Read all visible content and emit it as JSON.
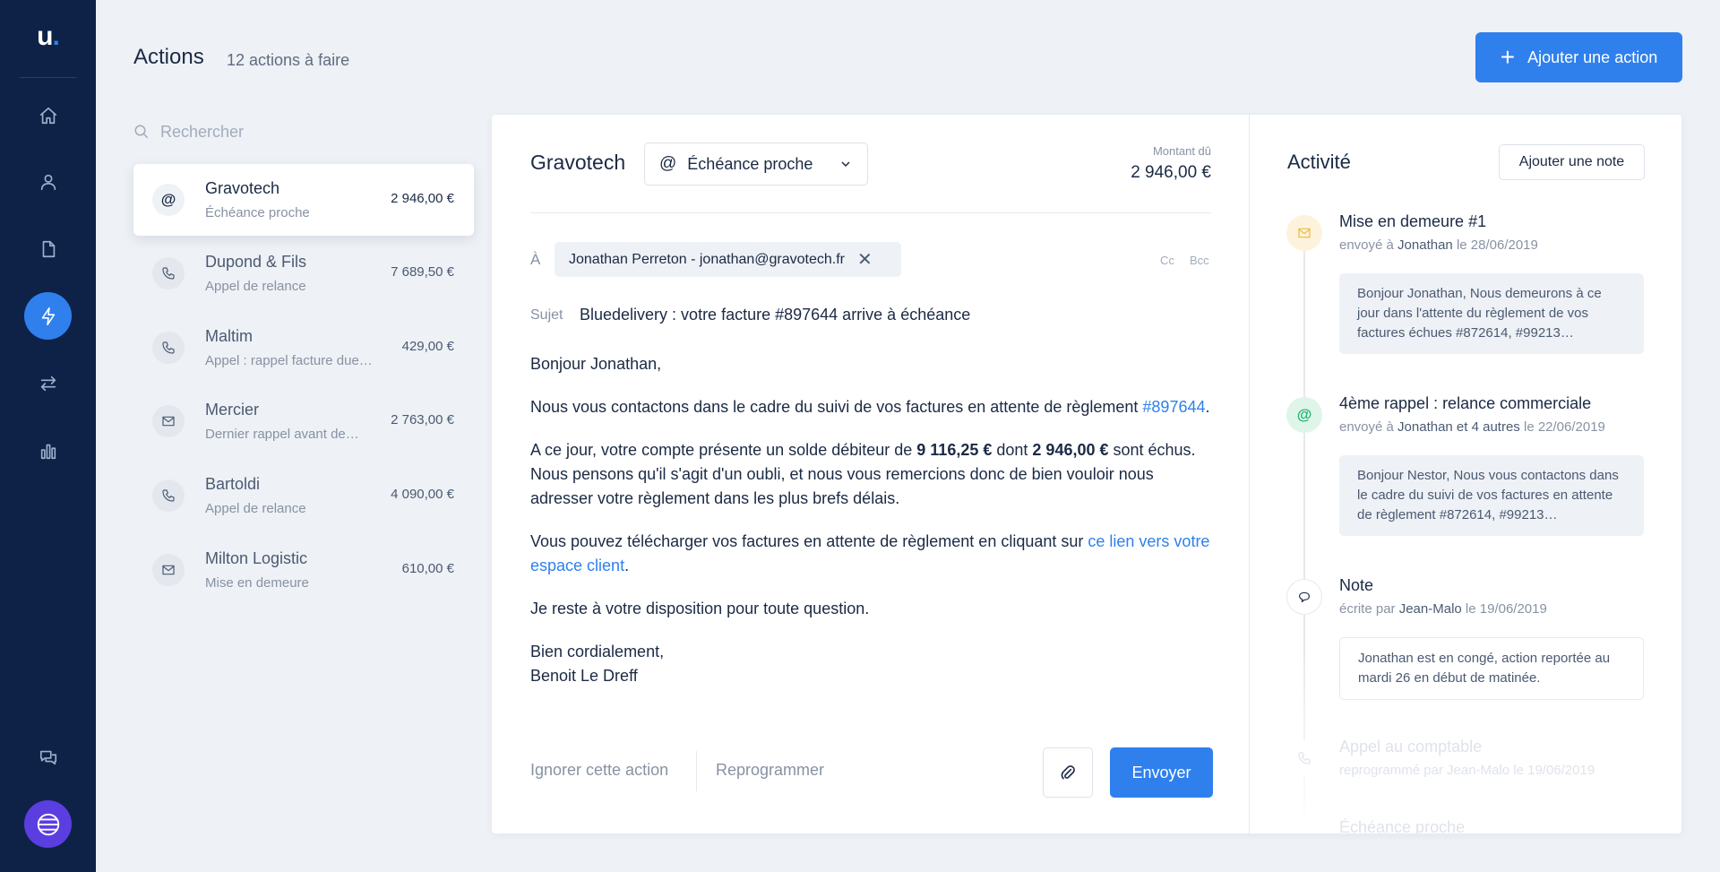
{
  "brand": {
    "logo_text": "u",
    "logo_dot": "."
  },
  "nav": [
    {
      "name": "home",
      "icon": "home-icon"
    },
    {
      "name": "contacts",
      "icon": "user-icon"
    },
    {
      "name": "invoices",
      "icon": "document-icon"
    },
    {
      "name": "actions",
      "icon": "lightning-icon",
      "active": true
    },
    {
      "name": "transfers",
      "icon": "transfer-arrows-icon"
    },
    {
      "name": "reports",
      "icon": "bar-chart-icon"
    },
    {
      "name": "messages",
      "icon": "chat-icon"
    }
  ],
  "header": {
    "title": "Actions",
    "count": "12 actions à faire",
    "add_button": "Ajouter une action"
  },
  "search": {
    "placeholder": "Rechercher"
  },
  "actions": [
    {
      "name": "Gravotech",
      "sub": "Échéance proche",
      "amount": "2 946,00 €",
      "icon": "at-icon",
      "selected": true
    },
    {
      "name": "Dupond & Fils",
      "sub": "Appel de relance",
      "amount": "7 689,50 €",
      "icon": "phone-icon"
    },
    {
      "name": "Maltim",
      "sub": "Appel : rappel facture due…",
      "amount": "429,00 €",
      "icon": "phone-icon"
    },
    {
      "name": "Mercier",
      "sub": "Dernier rappel avant de…",
      "amount": "2 763,00 €",
      "icon": "mail-icon"
    },
    {
      "name": "Bartoldi",
      "sub": "Appel de relance",
      "amount": "4 090,00 €",
      "icon": "phone-icon"
    },
    {
      "name": "Milton Logistic",
      "sub": "Mise en demeure",
      "amount": "610,00 €",
      "icon": "mail-icon"
    }
  ],
  "email": {
    "client": "Gravotech",
    "status": "Échéance proche",
    "amount_label": "Montant dû",
    "amount_value": "2 946,00 €",
    "to_label": "À",
    "recipient": "Jonathan Perreton - jonathan@gravotech.fr",
    "cc": "Cc",
    "bcc": "Bcc",
    "subject_label": "Sujet",
    "subject": "Bluedelivery : votre facture #897644 arrive à échéance",
    "greeting": "Bonjour Jonathan,",
    "p1_a": "Nous vous contactons dans le cadre du suivi de vos factures en attente de règlement ",
    "p1_link": "#897644",
    "p1_b": ".",
    "p2_a": "A ce jour, votre compte présente un solde débiteur de ",
    "p2_amount1": "9 116,25 €",
    "p2_b": " dont ",
    "p2_amount2": "2 946,00 €",
    "p2_c": " sont échus. Nous pensons qu'il s'agit d'un oubli, et nous vous remercions donc de bien vouloir nous adresser votre règlement dans les plus brefs délais.",
    "p3_a": "Vous pouvez télécharger vos factures en attente de règlement en cliquant sur ",
    "p3_link": "ce lien vers votre espace client",
    "p3_b": ".",
    "p4": "Je reste à votre disposition pour toute question.",
    "closing": "Bien cordialement,",
    "signature": "Benoit Le Dreff",
    "ignore": "Ignorer cette action",
    "reschedule": "Reprogrammer",
    "send": "Envoyer"
  },
  "activity": {
    "title": "Activité",
    "add_note": "Ajouter une note",
    "items": [
      {
        "title": "Mise en demeure #1",
        "meta_a": "envoyé à ",
        "meta_who": "Jonathan",
        "meta_b": " le 28/06/2019",
        "body": "Bonjour Jonathan, Nous demeurons à ce jour dans l'attente du règlement de vos factures échues #872614, #99213…",
        "icon": "mail-icon"
      },
      {
        "title": "4ème rappel : relance commerciale",
        "meta_a": "envoyé à ",
        "meta_who": "Jonathan et 4 autres",
        "meta_b": " le 22/06/2019",
        "body": "Bonjour Nestor, Nous vous contactons dans le cadre du suivi de vos factures en attente de règlement #872614, #99213…",
        "icon": "at-icon"
      },
      {
        "title": "Note",
        "meta_a": "écrite par ",
        "meta_who": "Jean-Malo",
        "meta_b": " le 19/06/2019",
        "body": "Jonathan est en congé, action reportée au mardi 26 en début de matinée.",
        "icon": "speech-bubble-icon"
      },
      {
        "title": "Appel au comptable",
        "meta_a": "reprogrammé par ",
        "meta_who": "Jean-Malo",
        "meta_b": " le 19/06/2019",
        "icon": "phone-icon"
      },
      {
        "title": "Échéance proche"
      }
    ]
  },
  "colors": {
    "sidebar": "#0e2248",
    "accent": "#2f80ed",
    "background": "#eef1f5",
    "avatar": "#5b3ee0"
  }
}
